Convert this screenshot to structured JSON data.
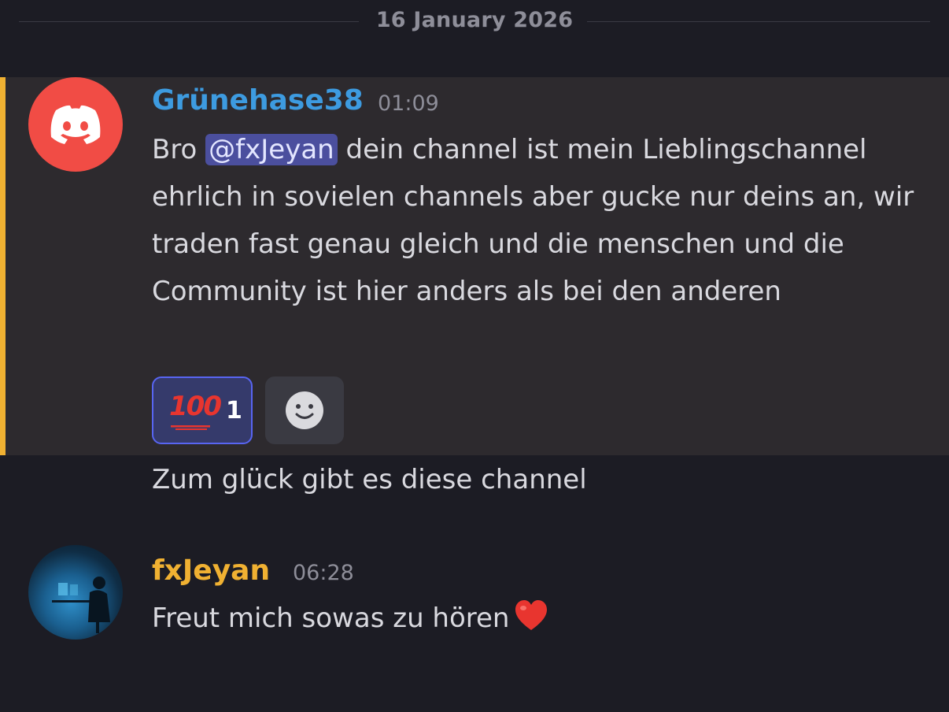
{
  "date_divider": "16 January 2026",
  "messages": [
    {
      "author": "Grünehase38",
      "time": "01:09",
      "text_before_mention": "Bro ",
      "mention": "@fxJeyan",
      "text_after_mention": " dein channel ist mein Lieblingschannel ehrlich in sovielen channels aber gucke nur deins an, wir traden fast genau gleich und die menschen und die Community ist hier anders als bei den anderen",
      "reactions": [
        {
          "emoji": "100",
          "count": "1"
        }
      ],
      "followup": "Zum glück gibt es diese channel"
    },
    {
      "author": "fxJeyan",
      "time": "06:28",
      "text": "Freut mich sowas zu hören"
    }
  ],
  "colors": {
    "background": "#1c1c24",
    "highlight_background": "#2d2a2e",
    "highlight_accent": "#f0b132",
    "author1": "#3d9be0",
    "author2": "#f0b132",
    "mention_bg": "#4b4f9e",
    "reaction_border": "#5865f2"
  },
  "icons": {
    "avatar1": "discord-logo-icon",
    "heart": "red-heart-emoji",
    "add_reaction": "smiley-icon",
    "reaction_emoji": "hundred-points-emoji"
  }
}
